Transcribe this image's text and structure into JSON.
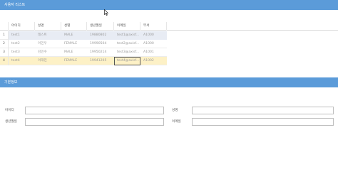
{
  "list_panel": {
    "title": "사용자 리스트",
    "columns": [
      "아이디",
      "성명",
      "성별",
      "생년월일",
      "이메일",
      "부서"
    ],
    "rows": [
      {
        "num": "1",
        "id": "test1",
        "name": "테스트",
        "gender": "MALE",
        "birth": "19880802",
        "email": "test1@axisf...",
        "dept": "A1000"
      },
      {
        "num": "2",
        "id": "test2",
        "name": "이민우",
        "gender": "FEMALE",
        "birth": "19990504",
        "email": "test2@axisf...",
        "dept": "A1000"
      },
      {
        "num": "3",
        "id": "test3",
        "name": "김민수",
        "gender": "MALE",
        "birth": "19950214",
        "email": "test3@axisf...",
        "dept": "A1001"
      },
      {
        "num": "4",
        "id": "test4",
        "name": "이태민",
        "gender": "FEMALE",
        "birth": "19941205",
        "email": "test4@axisf...",
        "dept": "A1002"
      }
    ]
  },
  "detail_panel": {
    "title": "기본정보",
    "fields": {
      "id_label": "아이디",
      "name_label": "성명",
      "birth_label": "생년월일",
      "email_label": "이메일",
      "id_value": "",
      "name_value": "",
      "birth_value": "",
      "email_value": ""
    }
  },
  "colors": {
    "header_bg": "#5b9bd9",
    "selected_row_bg": "#fdf1c6",
    "hover_row_bg": "#e8ecf4"
  },
  "icons": {
    "cursor": "mouse-pointer-icon"
  }
}
